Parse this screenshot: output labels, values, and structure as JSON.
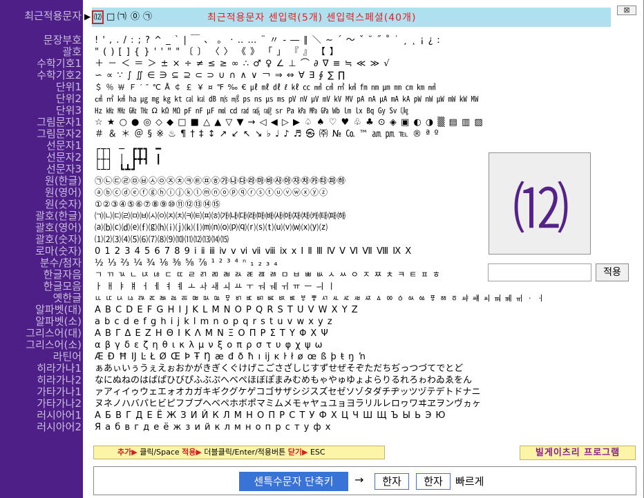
{
  "sidebar": {
    "items": [
      "최근적용문자",
      "문장부호",
      "괄호",
      "수학기호1",
      "수학기호2",
      "단위1",
      "단위2",
      "단위3",
      "그림문자1",
      "그림문자2",
      "선문자1",
      "선문자2",
      "선문자3",
      "원(한글)",
      "원(영어)",
      "원(숫자)",
      "괄호(한글)",
      "괄호(영어)",
      "괄호(숫자)",
      "로마(숫자)",
      "분수/첨자",
      "한글자음",
      "한글모음",
      "옛한글",
      "알파벳(대)",
      "알파벳(소)",
      "그리스어(대)",
      "그리스어(소)",
      "라틴어",
      "히라가나1",
      "히라가나2",
      "가타가나1",
      "가타가나2",
      "러시아어1",
      "러시아어2"
    ]
  },
  "topbar": {
    "recent_chars": [
      "⑿",
      "□",
      "㈀",
      "⓪",
      "㉠"
    ],
    "title": "최근적용문자  센입력(5개)  센입력스페셜(40개)",
    "close_label": "⊠"
  },
  "rows": {
    "punct1": "! ' , . / : ; ? ^ _ ` | ￣ 、 。 · ‥ … ¨ 〃 ‐ ― ∥ ＼ ∼ ´ ～ ˇ ˘ ˝ ˚ ˙ ¸ ˛ ¡ ¿ ː",
    "punct2": "\" ( ) [ ] { } ' ' \" \" 〔 〕 〈 〉 《 》 「 」 『 』 【 】",
    "math1": "＋ － ＜ ＝ ＞ ± × ÷ ≠ ≤ ≥ ∞ ∴ ♂ ♀ ∠ ⊥ ⌒ ∂ ∇ ≡ ≒ ≪ ≫ √",
    "math2": "∽ ∝ ∵ ∫ ∬ ∈ ∋ ⊆ ⊇ ⊂ ⊃ ∪ ∩ ∧ ∨ ￢ ⇒ ⇔ ∀ ∃ ∮ ∑ ∏",
    "unit1": "＄ ％ ￦ Ｆ ′ ″ ℃ Å ￠ ￡ ￥ ¤ ℉ ‰ € ㎕ ㎖ ㎗ ℓ ㎘ ㏄ ㎣ ㎤ ㎥ ㎦ ㎙ ㎚ ㎛ ㎜ ㎝ ㎞ ㎟",
    "unit2": "㎠ ㎡ ㎢ ㏊ ㎍ ㎎ ㎏ ㏏ ㎈ ㎉ ㏈ ㎧ ㎨ ㎰ ㎱ ㎲ ㎳ ㎴ ㎵ ㎶ ㎷ ㎸ ㎹ ㎀ ㎁ ㎂ ㎃ ㎄ ㎺ ㎻ ㎼ ㎽ ㎾ ㎿",
    "unit3": "㎐ ㎑ ㎒ ㎓ ㎔ Ω ㏀ ㏁ ㎊ ㎋ ㎌ ㏖ ㏅ ㎭ ㎮ ㎯ ㏛ ㎩ ㎪ ㎫ ㎬ ㏝ ㏐ ㏓ ㏃ ㏉ ㏜ ㏆",
    "pic1": "☆ ★ ○ ● ◎ ◇ ◆ □ ■ △ ▲ ▽ ▼ → ◁ ◀ ▷ ▶ ♤ ♠ ♡ ♥ ♧ ♣ ⊙ ◈ ▣ ◐ ◑ ▒ ▤ ▥ ▨ ▧ ▦ ▩",
    "pic2": "＃ ＆ ＊ ＠ § ※ ♨ ¶ † ‡ ↕ ↗ ↙ ↖ ↘ ♭ ♩ ♪ ♬ ㉿ ㈜ № ㏇ ™ ㏂ ㏘ ℡ ® ª º",
    "line1": "┌┬┐ ─ ┏┳┓ ━",
    "line2": "├┼┤ │ ┣╋┫ ┃",
    "line3": "└┴┘   ┗┻┛",
    "circle_kr": "㉠㉡㉢㉣㉤㉥㉦㉧㉨㉩㉪㉫㉬㉭㉮㉯㉰㉱㉲㉳㉴㉵㉶㉷㉸㉹㉺㉻",
    "circle_en": "ⓐⓑⓒⓓⓔⓕⓖⓗⓘⓙⓚⓛⓜⓝⓞⓟⓠⓡⓢⓣⓤⓥⓦⓧⓨⓩ",
    "circle_num": "①②③④⑤⑥⑦⑧⑨⑩⑪⑫⑬⑭⑮",
    "paren_kr": "㈀㈁㈂㈃㈄㈅㈆㈇㈈㈉㈊㈋㈌㈍㈎㈏㈐㈑㈒㈓㈔㈕㈖㈗㈘㈙㈚㈛",
    "paren_en": "⒜⒝⒞⒟⒠⒡⒢⒣⒤⒥⒦⒧⒨⒩⒪⒫⒬⒭⒮⒯⒰⒱⒲⒳⒴⒵",
    "paren_num": "⑴⑵⑶⑷⑸⑹⑺⑻⑼⑽⑾⑿⒀⒁⒂",
    "roman": "0 1 2 3 4 5 6 7 8 9 ⅰ ⅱ ⅲ ⅳ ⅴ ⅵ ⅶ ⅷ ⅸ ⅹ Ⅰ Ⅱ Ⅲ Ⅳ Ⅴ Ⅵ Ⅶ Ⅷ Ⅸ Ⅹ",
    "fraction": "½ ⅓ ⅔ ¼ ¾ ⅛ ⅜ ⅝ ⅞ ¹ ² ³ ⁴ ⁿ ₁ ₂ ₃ ₄",
    "jaeum": "ㄱ ㄲ ㄳ ㄴ ㄵ ㄶ ㄷ ㄸ ㄹ ㄺ ㄻ ㄼ ㄽ ㄾ ㄿ ㅀ ㅁ ㅂ ㅃ ㅄ ㅅ ㅆ ㅇ ㅈ ㅉ ㅊ ㅋ ㅌ ㅍ ㅎ",
    "moeum": "ㅏ ㅐ ㅑ ㅒ ㅓ ㅔ ㅕ ㅖ ㅗ ㅘ ㅙ ㅚ ㅛ ㅜ ㅝ ㅞ ㅟ ㅠ ㅡ ㅢ ㅣ",
    "old": "ㅥ ㅦ ㅧ ㅨ ㅩ ㅪ ㅫ ㅬ ㅭ ㅮ ㅯ ㅰ ㅱ ㅲ ㅳ ㅴ ㅵ ㅶ ㅷ ㅸ ㅹ ㅺ ㅻ ㅼ ㅽ ㅾ ㅿ ㆀ ㆁ ㆂ ㆃ ㆄ ㆅ ㆆ ㆇ ㆈ ㆉ ㆊ ㆋ ㆌ ㆍ ㆎ",
    "alpha_up": "A B C D E F G H I J K L M N O P Q R S T U V W X Y Z",
    "alpha_lo": "a b c d e f g h i j k l m n o p q r s t u v w x y z",
    "greek_up": "Α Β Γ Δ Ε Ζ Η Θ Ι Κ Λ Μ Ν Ξ Ο Π Ρ Σ Τ Υ Φ Χ Ψ",
    "greek_lo": "α β γ δ ε ζ η θ ι κ λ μ ν ξ ο π ρ σ τ υ φ χ ψ ω",
    "latin": "Æ Ð Ħ Ĳ Ŀ Ł Ø Œ Þ Ŧ Ŋ æ đ ð ħ ı ĳ ĸ ŀ ł ø œ ß þ ŧ ŋ ŉ",
    "hira1": "ぁあぃいぅうぇえぉおかがきぎくぐけげこごさざしじすずせぜそぞただちぢっつづてでとど",
    "hira2": "なにぬねのはばぱひびぴふぶぷへべぺほぼぽまみむめもゃやゅゆょよらりるれろゎわゐゑをん",
    "kata1": "ァアィイゥウェエォオカガキギクグケゲコゴサザシジスズセゼソゾタダチヂッツヅテデトドナニ",
    "kata2": "ヌネノハバパヒビピフブプヘベペホボポマミムメモャヤュユョヨラリルレロヮワヰヱヲンヴヵヶ",
    "rus1": "А Б В Г Д Е Ё Ж З И Й К Л М Н О П Р С Т У Ф Х Ц Ч Ш Щ Ъ Ы Ь Э Ю",
    "rus2": "Я а б в г д е ё ж з и й к л м н о п р с т у ф х"
  },
  "preview": {
    "char": "⑿"
  },
  "apply": {
    "input_value": "",
    "button_label": "적용"
  },
  "hint": {
    "add_key": "추가▶",
    "add_text": " 클릭/Space  ",
    "apply_key": "적용▶",
    "apply_text": " 더블클릭/Enter/적용버튼  ",
    "close_key": "닫기▶",
    "close_text": " ESC"
  },
  "program_label": "빌게이츠리 프로그램",
  "shortcut": {
    "button_label": "센특수문자 단축키",
    "arrow": "→",
    "key1": "한자",
    "key2": "한자",
    "fast": "빠르게"
  },
  "colors": {
    "sidebar_bg": "#4e2087",
    "sidebar_text": "#c9bde0",
    "topbar_bg": "#aee0f0",
    "title_red": "#e42020",
    "preview_color": "#552288",
    "shortcut_blue": "#3a73d6",
    "hint_bg": "#fcf5a8"
  }
}
